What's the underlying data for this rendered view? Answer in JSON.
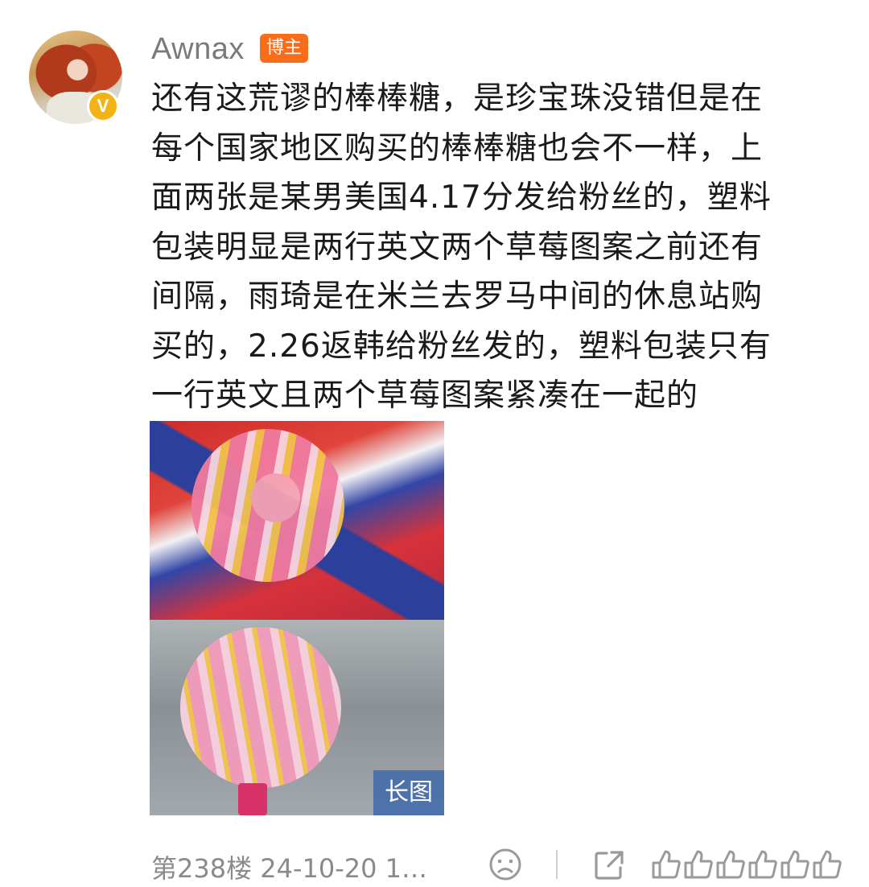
{
  "post": {
    "username": "Awnax",
    "role_badge": "博主",
    "verified_badge": "V",
    "text": "还有这荒谬的棒棒糖，是珍宝珠没错但是在\n每个国家地区购买的棒棒糖也会不一样，上\n面两张是某男美国4.17分发给粉丝的，塑料\n包装明显是两行英文两个草莓图案之前还有\n间隔，雨琦是在米兰去罗马中间的休息站购\n买的，2.26返韩给粉丝发的，塑料包装只有\n一行英文且两个草莓图案紧凑在一起的",
    "image_badge": "长图"
  },
  "footer": {
    "floor_time": "第238楼 24-10-20 1…"
  },
  "icons": [
    "avatar",
    "verified-icon",
    "emoji-icon",
    "share-icon",
    "like-icon"
  ],
  "colors": {
    "accent_orange": "#f86c1a",
    "verified_yellow": "#f2b414",
    "muted_text": "#8a8a8a"
  }
}
